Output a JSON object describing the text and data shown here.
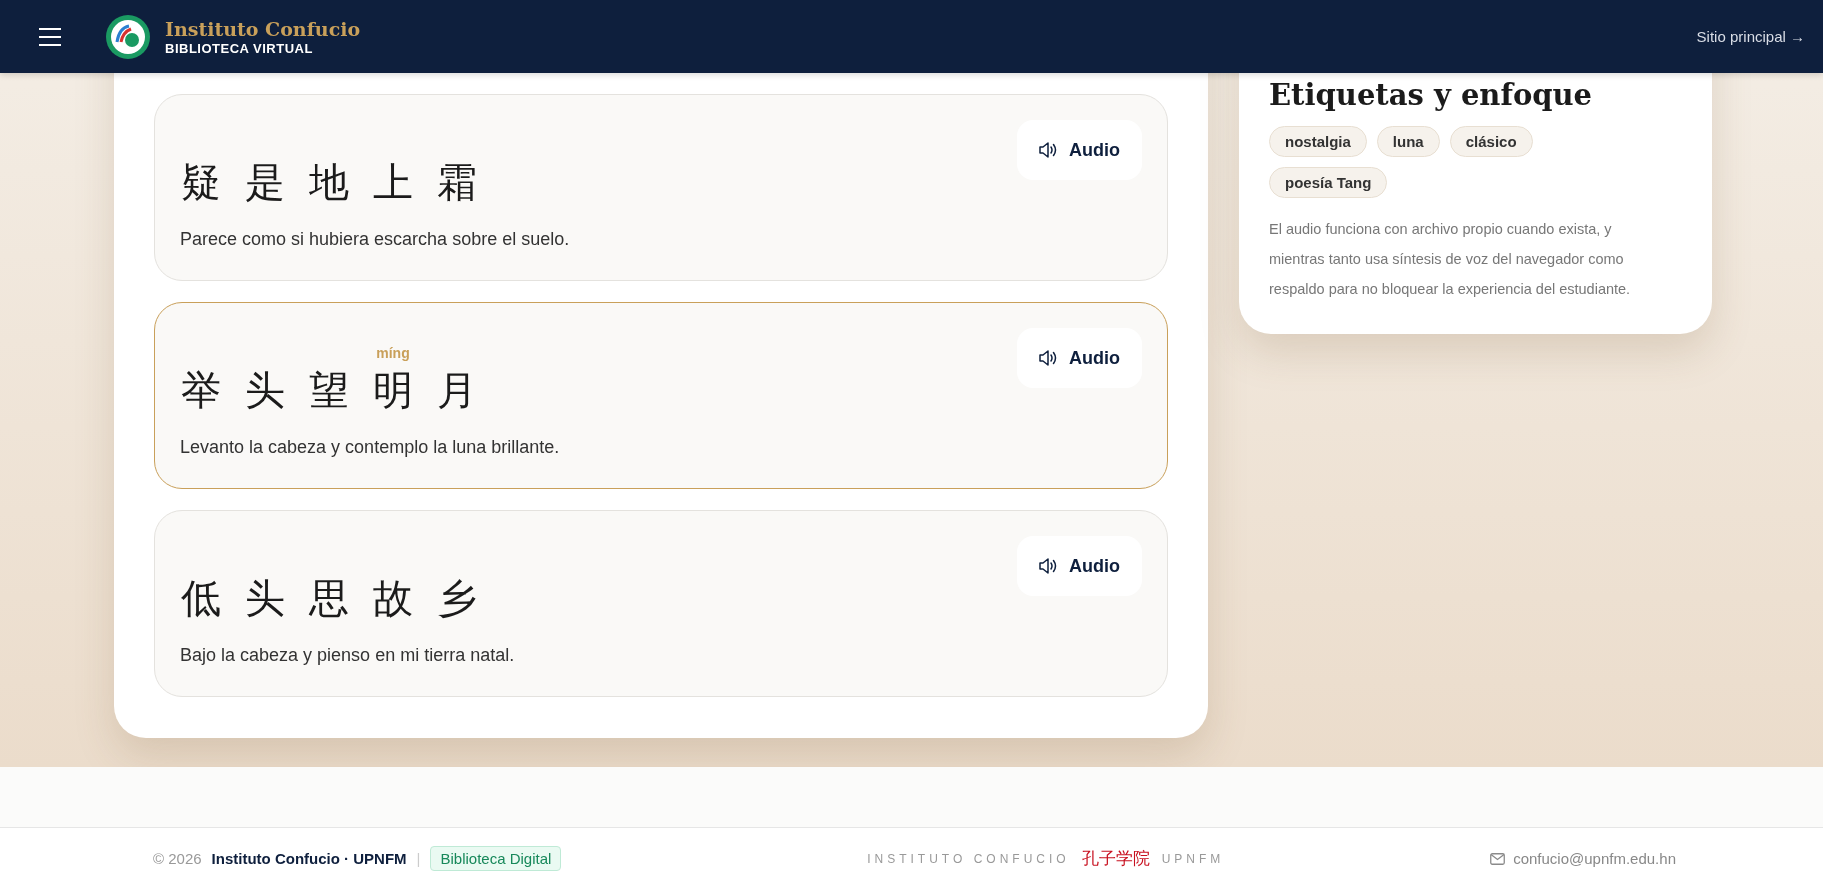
{
  "header": {
    "title": "Instituto Confucio",
    "subtitle": "BIBLIOTECA VIRTUAL",
    "link": "Sitio principal →"
  },
  "verses": [
    {
      "selected": false,
      "chars": [
        {
          "hanzi": "疑"
        },
        {
          "hanzi": "是"
        },
        {
          "hanzi": "地"
        },
        {
          "hanzi": "上"
        },
        {
          "hanzi": "霜"
        }
      ],
      "translation": "Parece como si hubiera escarcha sobre el suelo.",
      "audio": "Audio"
    },
    {
      "selected": true,
      "chars": [
        {
          "hanzi": "举"
        },
        {
          "hanzi": "头"
        },
        {
          "hanzi": "望"
        },
        {
          "hanzi": "明",
          "pinyin": "míng"
        },
        {
          "hanzi": "月"
        }
      ],
      "translation": "Levanto la cabeza y contemplo la luna brillante.",
      "audio": "Audio"
    },
    {
      "selected": false,
      "chars": [
        {
          "hanzi": "低"
        },
        {
          "hanzi": "头"
        },
        {
          "hanzi": "思"
        },
        {
          "hanzi": "故"
        },
        {
          "hanzi": "乡"
        }
      ],
      "translation": "Bajo la cabeza y pienso en mi tierra natal.",
      "audio": "Audio"
    }
  ],
  "aside": {
    "heading": "Etiquetas y enfoque",
    "tags": [
      "nostalgia",
      "luna",
      "clásico",
      "poesía Tang"
    ],
    "note": "El audio funciona con archivo propio cuando exista, y mientras tanto usa síntesis de voz del navegador como respaldo para no bloquear la experiencia del estudiante."
  },
  "footer": {
    "copyright": "© 2026",
    "org": "Instituto Confucio · UPNFM",
    "separator": "|",
    "badge": "Biblioteca Digital",
    "brand_left": "INSTITUTO CONFUCIO",
    "brand_cn": "孔子学院",
    "brand_right": "UPNFM",
    "email": "confucio@upnfm.edu.hn"
  }
}
